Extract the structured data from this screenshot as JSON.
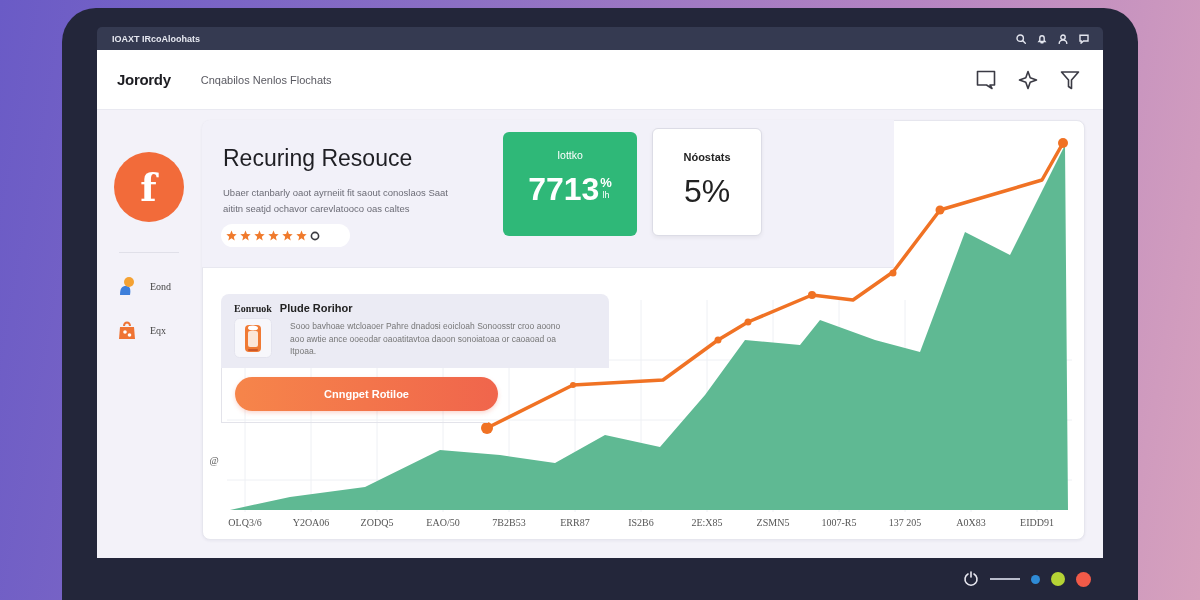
{
  "titlebar": {
    "title": "IOAXT IRcoAloohats"
  },
  "header": {
    "logo": "Jorordy",
    "nav": "Cnqabilos Nenlos Flochats"
  },
  "sidebar": {
    "avatar_letter": "f",
    "items": [
      {
        "label": "Eond",
        "kind": "person"
      },
      {
        "label": "Eqx",
        "kind": "bag"
      }
    ]
  },
  "hero": {
    "title": "Recuring Resouce",
    "description": "Ubaer ctanbarly oaot ayrneiit fit saout conoslaos Saat aititn seatjd ochavor carevlatooco oas caltes",
    "stars": 6
  },
  "stats": [
    {
      "kind": "accent",
      "label": "Iottko",
      "value": "7713",
      "unit": "%",
      "unit_caption": "lh"
    },
    {
      "kind": "plain",
      "label": "Nóostats",
      "value": "5%"
    }
  ],
  "feature": {
    "tag": "Eonruok",
    "title": "Plude Rorihor",
    "text": "Sooo bavhoae wtcloaoer Pahre dnadosi eoicloah Sonoosstr croo aoono aoo awtie ance ooeodar oaoatitavtoa daoon sonoiatoaa or caoaoad oa Itpoaa.",
    "button": "Cnngpet Rotiloe"
  },
  "chart": {
    "y_mark": "@",
    "x_labels": [
      "OLQ3/6",
      "Y2OA06",
      "ZODQ5",
      "EAO/50",
      "7B2B53",
      "ERR87",
      "IS2B6",
      "2E:X85",
      "ZSMN5",
      "1007-R5",
      "137 205",
      "A0X83",
      "EIDD91"
    ]
  },
  "bezel": {
    "indicators": [
      {
        "color": "#2f8bd6"
      },
      {
        "color": "#b5d335"
      },
      {
        "color": "#f15a48"
      }
    ]
  }
}
